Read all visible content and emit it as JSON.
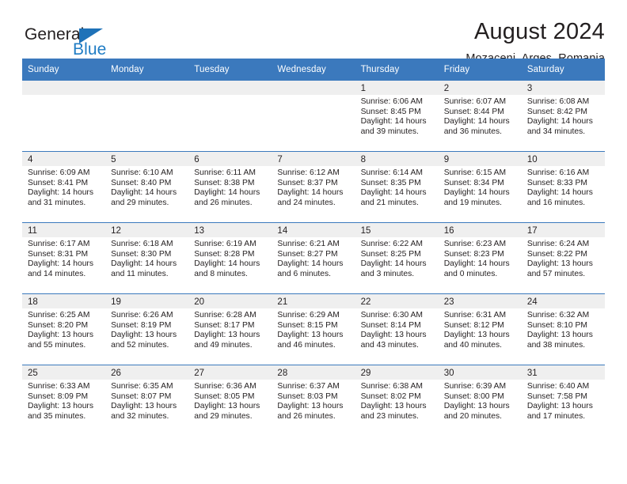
{
  "brand": {
    "name_part1": "General",
    "name_part2": "Blue",
    "accent_color": "#1f7cc4",
    "triangle_color": "#1f72b8"
  },
  "header": {
    "title": "August 2024",
    "location": "Mozaceni, Arges, Romania",
    "header_bg": "#3b79bd",
    "daynum_bg": "#efefef"
  },
  "weekdays": [
    "Sunday",
    "Monday",
    "Tuesday",
    "Wednesday",
    "Thursday",
    "Friday",
    "Saturday"
  ],
  "weeks": [
    [
      {
        "day": "",
        "sunrise": "",
        "sunset": "",
        "daylight_line1": "",
        "daylight_line2": ""
      },
      {
        "day": "",
        "sunrise": "",
        "sunset": "",
        "daylight_line1": "",
        "daylight_line2": ""
      },
      {
        "day": "",
        "sunrise": "",
        "sunset": "",
        "daylight_line1": "",
        "daylight_line2": ""
      },
      {
        "day": "",
        "sunrise": "",
        "sunset": "",
        "daylight_line1": "",
        "daylight_line2": ""
      },
      {
        "day": "1",
        "sunrise": "Sunrise: 6:06 AM",
        "sunset": "Sunset: 8:45 PM",
        "daylight_line1": "Daylight: 14 hours",
        "daylight_line2": "and 39 minutes."
      },
      {
        "day": "2",
        "sunrise": "Sunrise: 6:07 AM",
        "sunset": "Sunset: 8:44 PM",
        "daylight_line1": "Daylight: 14 hours",
        "daylight_line2": "and 36 minutes."
      },
      {
        "day": "3",
        "sunrise": "Sunrise: 6:08 AM",
        "sunset": "Sunset: 8:42 PM",
        "daylight_line1": "Daylight: 14 hours",
        "daylight_line2": "and 34 minutes."
      }
    ],
    [
      {
        "day": "4",
        "sunrise": "Sunrise: 6:09 AM",
        "sunset": "Sunset: 8:41 PM",
        "daylight_line1": "Daylight: 14 hours",
        "daylight_line2": "and 31 minutes."
      },
      {
        "day": "5",
        "sunrise": "Sunrise: 6:10 AM",
        "sunset": "Sunset: 8:40 PM",
        "daylight_line1": "Daylight: 14 hours",
        "daylight_line2": "and 29 minutes."
      },
      {
        "day": "6",
        "sunrise": "Sunrise: 6:11 AM",
        "sunset": "Sunset: 8:38 PM",
        "daylight_line1": "Daylight: 14 hours",
        "daylight_line2": "and 26 minutes."
      },
      {
        "day": "7",
        "sunrise": "Sunrise: 6:12 AM",
        "sunset": "Sunset: 8:37 PM",
        "daylight_line1": "Daylight: 14 hours",
        "daylight_line2": "and 24 minutes."
      },
      {
        "day": "8",
        "sunrise": "Sunrise: 6:14 AM",
        "sunset": "Sunset: 8:35 PM",
        "daylight_line1": "Daylight: 14 hours",
        "daylight_line2": "and 21 minutes."
      },
      {
        "day": "9",
        "sunrise": "Sunrise: 6:15 AM",
        "sunset": "Sunset: 8:34 PM",
        "daylight_line1": "Daylight: 14 hours",
        "daylight_line2": "and 19 minutes."
      },
      {
        "day": "10",
        "sunrise": "Sunrise: 6:16 AM",
        "sunset": "Sunset: 8:33 PM",
        "daylight_line1": "Daylight: 14 hours",
        "daylight_line2": "and 16 minutes."
      }
    ],
    [
      {
        "day": "11",
        "sunrise": "Sunrise: 6:17 AM",
        "sunset": "Sunset: 8:31 PM",
        "daylight_line1": "Daylight: 14 hours",
        "daylight_line2": "and 14 minutes."
      },
      {
        "day": "12",
        "sunrise": "Sunrise: 6:18 AM",
        "sunset": "Sunset: 8:30 PM",
        "daylight_line1": "Daylight: 14 hours",
        "daylight_line2": "and 11 minutes."
      },
      {
        "day": "13",
        "sunrise": "Sunrise: 6:19 AM",
        "sunset": "Sunset: 8:28 PM",
        "daylight_line1": "Daylight: 14 hours",
        "daylight_line2": "and 8 minutes."
      },
      {
        "day": "14",
        "sunrise": "Sunrise: 6:21 AM",
        "sunset": "Sunset: 8:27 PM",
        "daylight_line1": "Daylight: 14 hours",
        "daylight_line2": "and 6 minutes."
      },
      {
        "day": "15",
        "sunrise": "Sunrise: 6:22 AM",
        "sunset": "Sunset: 8:25 PM",
        "daylight_line1": "Daylight: 14 hours",
        "daylight_line2": "and 3 minutes."
      },
      {
        "day": "16",
        "sunrise": "Sunrise: 6:23 AM",
        "sunset": "Sunset: 8:23 PM",
        "daylight_line1": "Daylight: 14 hours",
        "daylight_line2": "and 0 minutes."
      },
      {
        "day": "17",
        "sunrise": "Sunrise: 6:24 AM",
        "sunset": "Sunset: 8:22 PM",
        "daylight_line1": "Daylight: 13 hours",
        "daylight_line2": "and 57 minutes."
      }
    ],
    [
      {
        "day": "18",
        "sunrise": "Sunrise: 6:25 AM",
        "sunset": "Sunset: 8:20 PM",
        "daylight_line1": "Daylight: 13 hours",
        "daylight_line2": "and 55 minutes."
      },
      {
        "day": "19",
        "sunrise": "Sunrise: 6:26 AM",
        "sunset": "Sunset: 8:19 PM",
        "daylight_line1": "Daylight: 13 hours",
        "daylight_line2": "and 52 minutes."
      },
      {
        "day": "20",
        "sunrise": "Sunrise: 6:28 AM",
        "sunset": "Sunset: 8:17 PM",
        "daylight_line1": "Daylight: 13 hours",
        "daylight_line2": "and 49 minutes."
      },
      {
        "day": "21",
        "sunrise": "Sunrise: 6:29 AM",
        "sunset": "Sunset: 8:15 PM",
        "daylight_line1": "Daylight: 13 hours",
        "daylight_line2": "and 46 minutes."
      },
      {
        "day": "22",
        "sunrise": "Sunrise: 6:30 AM",
        "sunset": "Sunset: 8:14 PM",
        "daylight_line1": "Daylight: 13 hours",
        "daylight_line2": "and 43 minutes."
      },
      {
        "day": "23",
        "sunrise": "Sunrise: 6:31 AM",
        "sunset": "Sunset: 8:12 PM",
        "daylight_line1": "Daylight: 13 hours",
        "daylight_line2": "and 40 minutes."
      },
      {
        "day": "24",
        "sunrise": "Sunrise: 6:32 AM",
        "sunset": "Sunset: 8:10 PM",
        "daylight_line1": "Daylight: 13 hours",
        "daylight_line2": "and 38 minutes."
      }
    ],
    [
      {
        "day": "25",
        "sunrise": "Sunrise: 6:33 AM",
        "sunset": "Sunset: 8:09 PM",
        "daylight_line1": "Daylight: 13 hours",
        "daylight_line2": "and 35 minutes."
      },
      {
        "day": "26",
        "sunrise": "Sunrise: 6:35 AM",
        "sunset": "Sunset: 8:07 PM",
        "daylight_line1": "Daylight: 13 hours",
        "daylight_line2": "and 32 minutes."
      },
      {
        "day": "27",
        "sunrise": "Sunrise: 6:36 AM",
        "sunset": "Sunset: 8:05 PM",
        "daylight_line1": "Daylight: 13 hours",
        "daylight_line2": "and 29 minutes."
      },
      {
        "day": "28",
        "sunrise": "Sunrise: 6:37 AM",
        "sunset": "Sunset: 8:03 PM",
        "daylight_line1": "Daylight: 13 hours",
        "daylight_line2": "and 26 minutes."
      },
      {
        "day": "29",
        "sunrise": "Sunrise: 6:38 AM",
        "sunset": "Sunset: 8:02 PM",
        "daylight_line1": "Daylight: 13 hours",
        "daylight_line2": "and 23 minutes."
      },
      {
        "day": "30",
        "sunrise": "Sunrise: 6:39 AM",
        "sunset": "Sunset: 8:00 PM",
        "daylight_line1": "Daylight: 13 hours",
        "daylight_line2": "and 20 minutes."
      },
      {
        "day": "31",
        "sunrise": "Sunrise: 6:40 AM",
        "sunset": "Sunset: 7:58 PM",
        "daylight_line1": "Daylight: 13 hours",
        "daylight_line2": "and 17 minutes."
      }
    ]
  ]
}
